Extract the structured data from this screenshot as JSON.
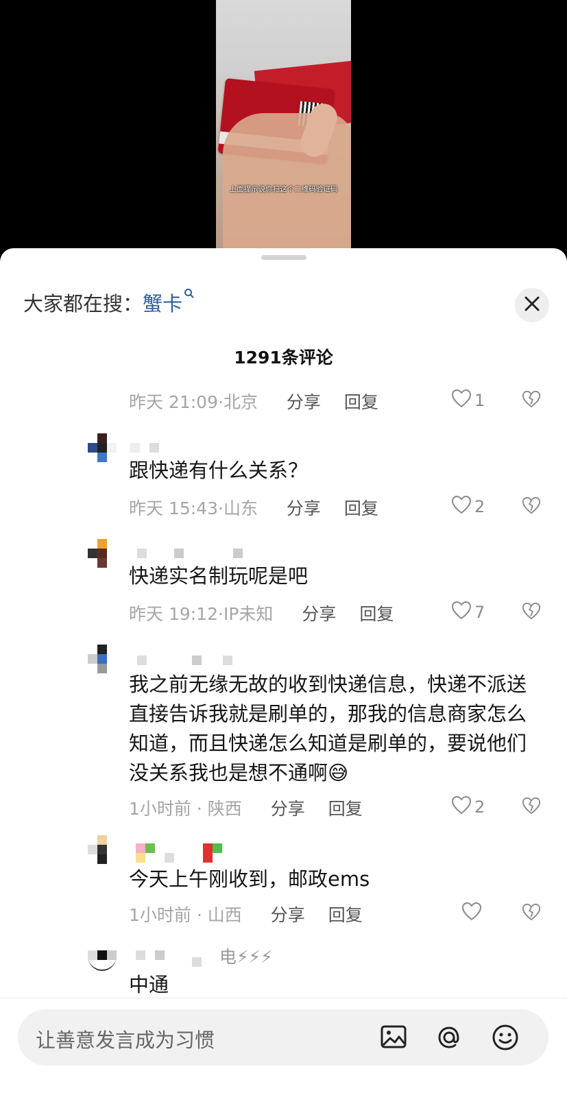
{
  "video": {
    "caption": "上面提示说你扫这个二维码验证码"
  },
  "search": {
    "prefix": "大家都在搜：",
    "keyword": "蟹卡"
  },
  "comments_count": "1291条评论",
  "comments": [
    {
      "text": "",
      "time": "昨天 21:09",
      "location": "北京",
      "share": "分享",
      "reply": "回复",
      "likes": "1"
    },
    {
      "text": "跟快递有什么关系？",
      "time": "昨天 15:43",
      "location": "山东",
      "share": "分享",
      "reply": "回复",
      "likes": "2"
    },
    {
      "text": "快递实名制玩呢是吧",
      "time": "昨天 19:12",
      "location": "IP未知",
      "share": "分享",
      "reply": "回复",
      "likes": "7"
    },
    {
      "text": "我之前无缘无故的收到快递信息，快递不派送直接告诉我就是刷单的，那我的信息商家怎么知道，而且快递怎么知道是刷单的，要说他们没关系我也是想不通啊😅",
      "time": "1小时前",
      "location": "陕西",
      "share": "分享",
      "reply": "回复",
      "likes": "2"
    },
    {
      "text": "今天上午刚收到，邮政ems",
      "time": "1小时前",
      "location": "山西",
      "share": "分享",
      "reply": "回复",
      "likes": ""
    },
    {
      "text": "中通",
      "name_suffix": "电⚡⚡⚡"
    }
  ],
  "input": {
    "placeholder": "让善意发言成为习惯"
  },
  "icons": {
    "close": "close-icon",
    "image": "image-icon",
    "at": "at-icon",
    "emoji": "emoji-icon",
    "like": "heart-icon",
    "dislike": "broken-heart-icon",
    "search": "search-icon"
  },
  "colors": {
    "keyword": "#2f5f9e",
    "meta": "#a5a5a5",
    "text": "#161616"
  }
}
